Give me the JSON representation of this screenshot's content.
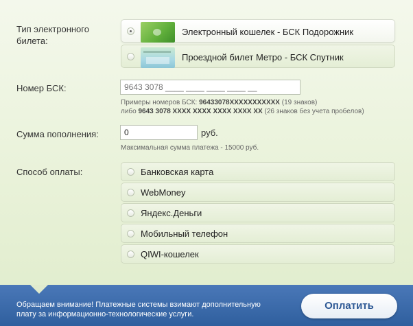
{
  "ticket": {
    "label": "Тип электронного билета:",
    "options": [
      {
        "label": "Электронный кошелек - БСК Подорожник",
        "selected": true,
        "card_color": "#7cc04a"
      },
      {
        "label": "Проездной билет Метро - БСК Спутник",
        "selected": false,
        "card_color": "#9fd0dc"
      }
    ]
  },
  "bsk": {
    "label": "Номер БСК:",
    "placeholder": "9643 3078 ____ ____ ____ ____ __",
    "hint_line1_prefix": "Примеры номеров БСК: ",
    "hint_line1_bold": "96433078XXXXXXXXXXX",
    "hint_line1_suffix": " (19 знаков)",
    "hint_line2_prefix": "либо ",
    "hint_line2_bold": "9643 3078 XXXX XXXX XXXX XXXX XX",
    "hint_line2_suffix": " (26 знаков без учета пробелов)"
  },
  "amount": {
    "label": "Сумма пополнения:",
    "value": "0",
    "unit": "руб.",
    "hint": "Максимальная сумма платежа - 15000 руб."
  },
  "payment": {
    "label": "Способ оплаты:",
    "options": [
      "Банковская карта",
      "WebMoney",
      "Яндекс.Деньги",
      "Мобильный телефон",
      "QIWI-кошелек"
    ]
  },
  "footer": {
    "notice": "Обращаем внимание! Платежные системы взимают дополнительную плату за информационно-технологические услуги.",
    "pay_button": "Оплатить"
  }
}
